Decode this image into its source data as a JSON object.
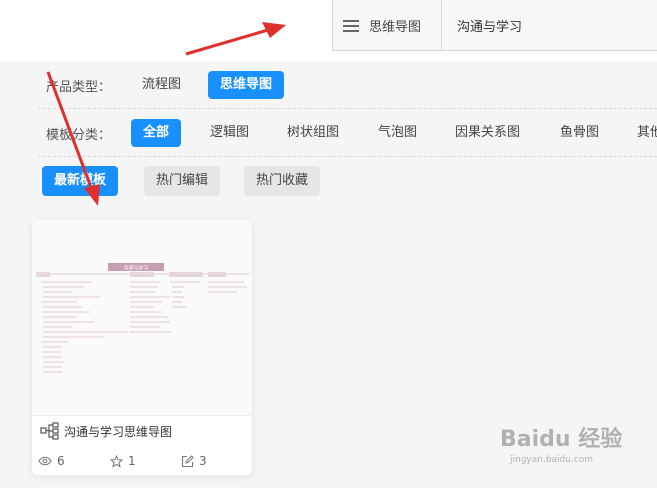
{
  "header": {
    "menu_tab": "思维导图",
    "active_doc_tab": "沟通与学习"
  },
  "filters": {
    "product_type": {
      "label": "产品类型：",
      "options": [
        "流程图",
        "思维导图"
      ],
      "selected": "思维导图"
    },
    "template_category": {
      "label": "模板分类：",
      "options": [
        "全部",
        "逻辑图",
        "树状组图",
        "气泡图",
        "因果关系图",
        "鱼骨图",
        "其他"
      ],
      "selected": "全部"
    },
    "sort_tabs": {
      "options": [
        "最新模板",
        "热门编辑",
        "热门收藏"
      ],
      "selected": "最新模板"
    }
  },
  "card": {
    "title": "沟通与学习思维导图",
    "thumb_title": "沟通与学习",
    "views": "6",
    "likes": "1",
    "edits": "3"
  },
  "watermark": {
    "brand": "Baidu 经验",
    "url": "jingyan.baidu.com"
  },
  "colors": {
    "accent": "#1890ff",
    "annotation_arrow": "#e0302b",
    "thumb_header": "#c79fb2"
  }
}
